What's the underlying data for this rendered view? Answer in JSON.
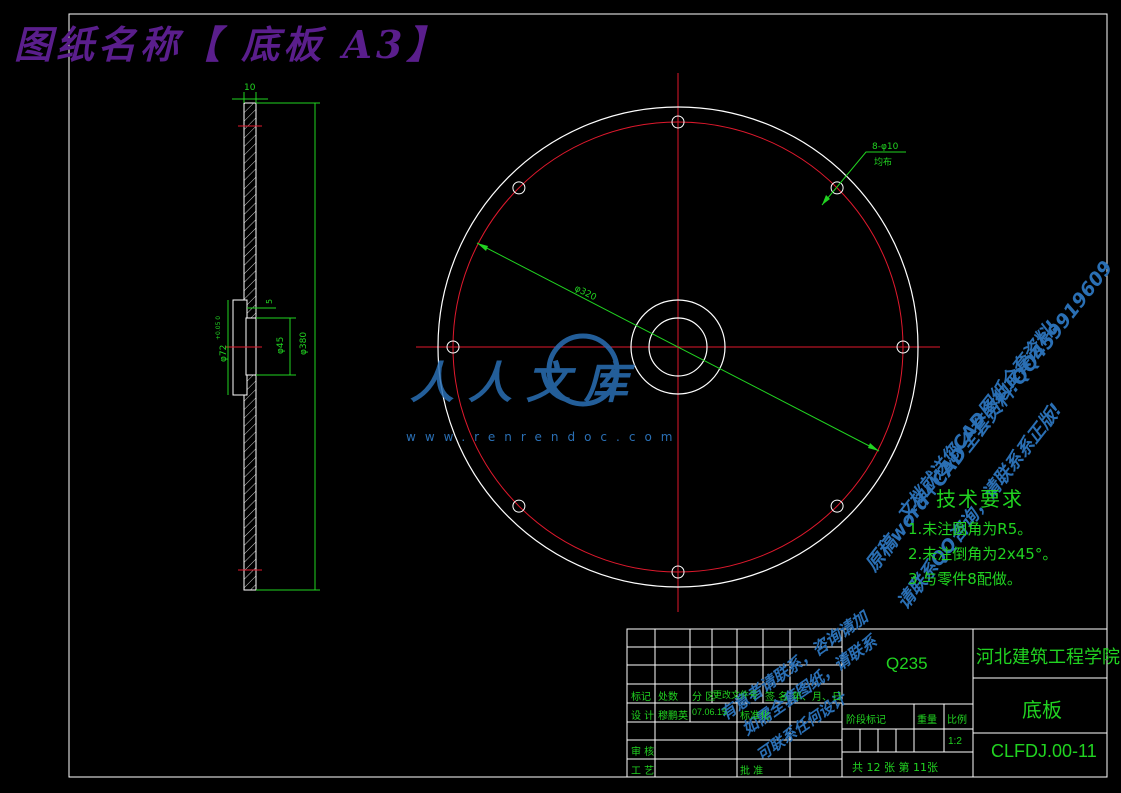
{
  "header": {
    "title": "图纸名称【 底板 A3】"
  },
  "colors": {
    "background": "#000000",
    "frame": "#ffffff",
    "title": "#5a1e8c",
    "centerline": "#e0192d",
    "dimension": "#21d321",
    "watermark": "#2a6fb4",
    "tech_text": "#21d321",
    "tb_text": "#21d321",
    "tb_big_text": "#21d321"
  },
  "dimensions": {
    "thickness": "10",
    "hole_pattern": "8-φ10",
    "hole_note": "均布",
    "bolt_circle": "φ320",
    "bore_small": "φ45",
    "hub_dia": "φ72",
    "hub_tol": "+0.05 0",
    "depth": "5",
    "outer": "φ380"
  },
  "watermark": {
    "logo_text": "人人文库",
    "site": "www.renrendoc.com",
    "diag_lines": [
      "文档就送您CAD图纸全套资料!",
      "原稿word+CAD全套资料!QQ459919609",
      "请联系QQ咨询，请联系系正版!"
    ],
    "diag_lines_2": [
      "有意者请联系，咨询请加",
      "如需全套图纸，请联系",
      "可联系任何设计"
    ]
  },
  "tech_requirements": {
    "heading": "技术要求",
    "items": [
      "1.未注圆角为R5。",
      "2.未注倒角为2x45°。",
      "3.与零件8配做。"
    ]
  },
  "title_block": {
    "material": "Q235",
    "school": "河北建筑工程学院",
    "part_name": "底板",
    "drawing_no": "CLFDJ.00-11",
    "scale": "1:2",
    "sheet_info": "共  12  张   第   11张",
    "row_labels": [
      "标记",
      "处数",
      "分 区",
      "更改文件号",
      "签 名",
      "年、月、日"
    ],
    "design_row": [
      "设 计",
      "穆鹏英",
      "07.06.15",
      "标准化"
    ],
    "stage_labels": [
      "阶段标记",
      "重量",
      "比例"
    ],
    "review": "审 核",
    "process": "工 艺",
    "approve": "批 准"
  }
}
